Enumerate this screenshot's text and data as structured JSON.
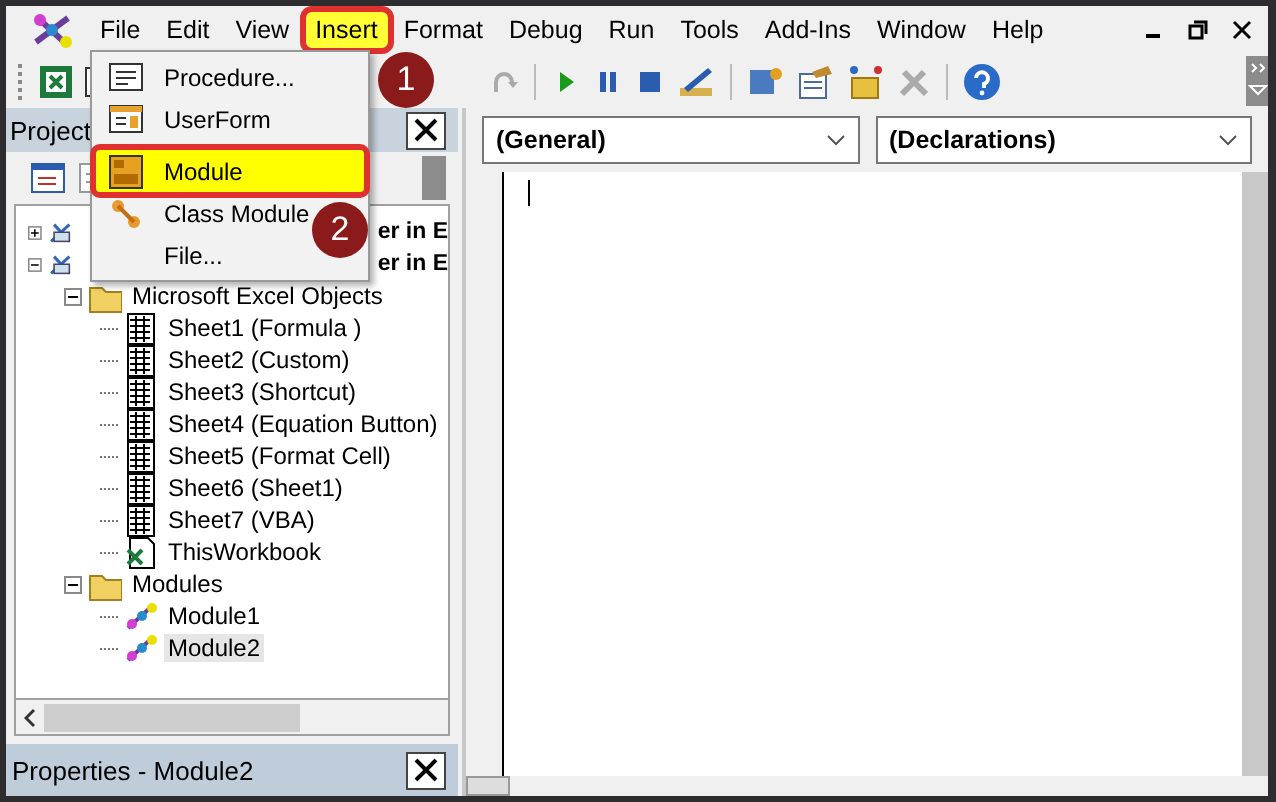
{
  "menu_bar": [
    {
      "label": "File",
      "selected": false
    },
    {
      "label": "Edit",
      "selected": false
    },
    {
      "label": "View",
      "selected": false
    },
    {
      "label": "Insert",
      "selected": true
    },
    {
      "label": "Format",
      "selected": false
    },
    {
      "label": "Debug",
      "selected": false
    },
    {
      "label": "Run",
      "selected": false
    },
    {
      "label": "Tools",
      "selected": false
    },
    {
      "label": "Add-Ins",
      "selected": false
    },
    {
      "label": "Window",
      "selected": false
    },
    {
      "label": "Help",
      "selected": false
    }
  ],
  "insert_menu": [
    {
      "label": "Procedure...",
      "kind": "procedure",
      "selected": false
    },
    {
      "label": "UserForm",
      "kind": "userform",
      "selected": false
    },
    {
      "label": "Module",
      "kind": "module",
      "selected": true
    },
    {
      "label": "Class Module",
      "kind": "class",
      "selected": false
    },
    {
      "label": "File...",
      "kind": "none",
      "selected": false
    }
  ],
  "callouts": [
    "1",
    "2"
  ],
  "project_panel": {
    "title": "Project",
    "tree": [
      {
        "label": "er in E",
        "kind": "project",
        "expanded": false
      },
      {
        "label": "er in E",
        "kind": "project",
        "expanded": true,
        "children": [
          {
            "label": "Microsoft Excel Objects",
            "kind": "folder",
            "expanded": true,
            "children": [
              {
                "label": "Sheet1 (Formula )",
                "kind": "sheet",
                "selected": false
              },
              {
                "label": "Sheet2 (Custom)",
                "kind": "sheet",
                "selected": false
              },
              {
                "label": "Sheet3 (Shortcut)",
                "kind": "sheet",
                "selected": false
              },
              {
                "label": "Sheet4 (Equation Button)",
                "kind": "sheet",
                "selected": false
              },
              {
                "label": "Sheet5 (Format Cell)",
                "kind": "sheet",
                "selected": false
              },
              {
                "label": "Sheet6 (Sheet1)",
                "kind": "sheet",
                "selected": false
              },
              {
                "label": "Sheet7 (VBA)",
                "kind": "sheet",
                "selected": false
              },
              {
                "label": "ThisWorkbook",
                "kind": "workbook",
                "selected": false
              }
            ]
          },
          {
            "label": "Modules",
            "kind": "folder",
            "expanded": true,
            "children": [
              {
                "label": "Module1",
                "kind": "module",
                "selected": false
              },
              {
                "label": "Module2",
                "kind": "module",
                "selected": true
              }
            ]
          }
        ]
      }
    ]
  },
  "properties_panel": {
    "title": "Properties - Module2"
  },
  "code_window": {
    "object": "(General)",
    "procedure": "(Declarations)"
  }
}
